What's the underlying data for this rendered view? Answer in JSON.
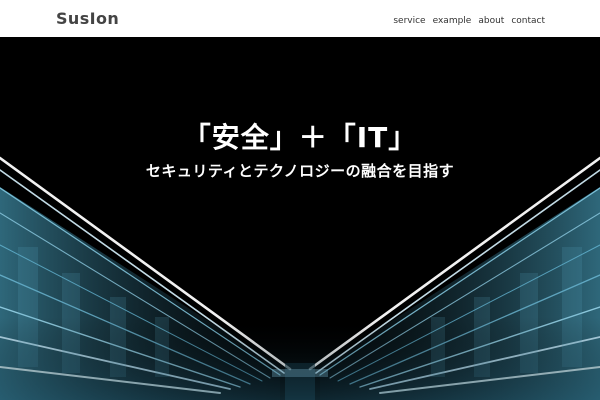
{
  "header": {
    "brand": "SusIon",
    "nav": [
      {
        "label": "service"
      },
      {
        "label": "example"
      },
      {
        "label": "about"
      },
      {
        "label": "contact"
      }
    ]
  },
  "hero": {
    "headline": "「安全」＋「IT」",
    "subline": "セキュリティとテクノロジーの融合を目指す"
  },
  "colors": {
    "header_bg": "#ffffff",
    "hero_bg": "#000000",
    "hero_text": "#ffffff",
    "light_streak": "#bfe9ff",
    "panel_glow": "#2f6f86"
  }
}
